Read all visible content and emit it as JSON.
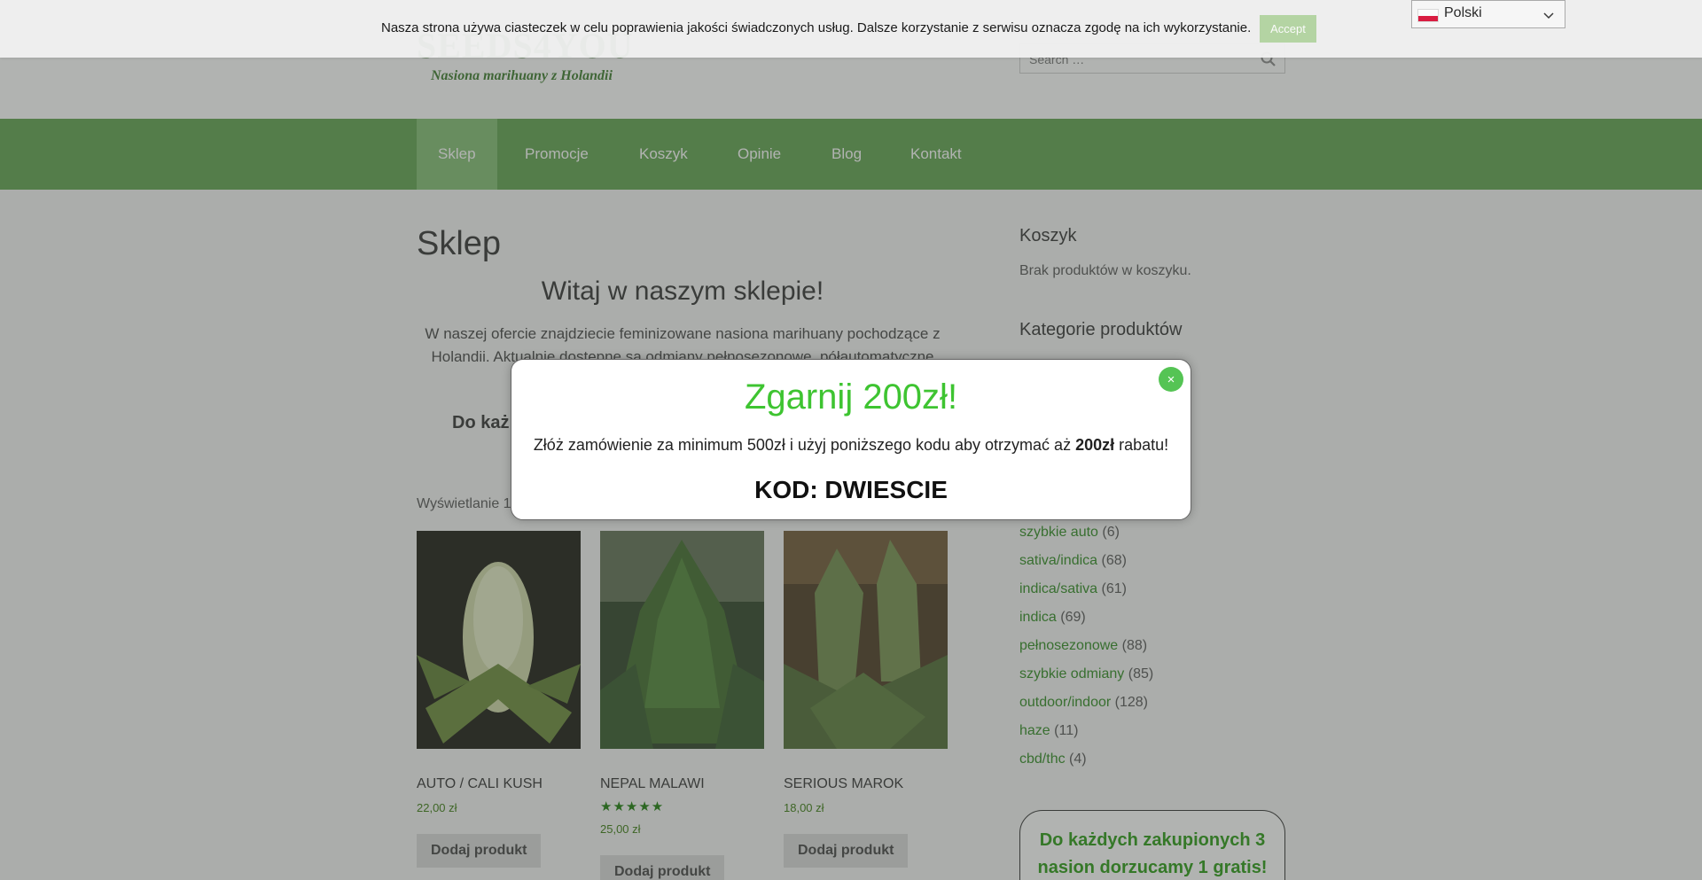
{
  "site": {
    "logo": "SEEDS4YOU",
    "tagline": "Nasiona marihuany z Holandii"
  },
  "search": {
    "placeholder": "Search …"
  },
  "nav": {
    "items": [
      {
        "label": "Sklep",
        "active": true
      },
      {
        "label": "Promocje"
      },
      {
        "label": "Koszyk"
      },
      {
        "label": "Opinie"
      },
      {
        "label": "Blog"
      },
      {
        "label": "Kontakt"
      }
    ]
  },
  "main": {
    "page_title": "Sklep",
    "welcome_title": "Witaj w naszym sklepie!",
    "welcome_text": "W naszej ofercie znajdziecie feminizowane nasiona marihuany pochodzące z Holandii. Aktualnie dostępne są odmiany pełnosezonowe, półautomatyczne jak i",
    "promo_line": "Do każ",
    "result_count": "Wyświetlanie 1",
    "products": [
      {
        "name": "AUTO / CALI KUSH",
        "price": "22,00 zł",
        "button": "Dodaj produkt",
        "rating": null
      },
      {
        "name": "NEPAL MALAWI",
        "price": "25,00 zł",
        "button": "Dodaj produkt",
        "rating": "★★★★★",
        "rating_value": 5
      },
      {
        "name": "SERIOUS MAROK",
        "price": "18,00 zł",
        "button": "Dodaj produkt",
        "rating": null
      }
    ]
  },
  "sidebar": {
    "cart_title": "Koszyk",
    "cart_empty": "Brak produktów w koszyku.",
    "categories_title": "Kategorie produktów",
    "categories": [
      {
        "name": "szybkie auto",
        "count": "(6)"
      },
      {
        "name": "sativa/indica",
        "count": "(68)"
      },
      {
        "name": "indica/sativa",
        "count": "(61)"
      },
      {
        "name": "indica",
        "count": "(69)"
      },
      {
        "name": "pełnosezonowe",
        "count": "(88)"
      },
      {
        "name": "szybkie odmiany",
        "count": "(85)"
      },
      {
        "name": "outdoor/indoor",
        "count": "(128)"
      },
      {
        "name": "haze",
        "count": "(11)"
      },
      {
        "name": "cbd/thc",
        "count": "(4)"
      }
    ],
    "gift_text": "Do każdych zakupionych 3 nasion dorzucamy 1 gratis!"
  },
  "cookie": {
    "text": "Nasza strona używa ciasteczek w celu poprawienia jakości świadczonych usług. Dalsze korzystanie z serwisu oznacza zgodę na ich wykorzystanie.",
    "accept_label": "Accept"
  },
  "language": {
    "selected": "Polski"
  },
  "popup": {
    "title": "Zgarnij 200zł!",
    "body_before": "Złóż zamówienie za minimum 500zł i użyj poniższego kodu aby otrzymać aż ",
    "body_bold": "200zł",
    "body_after": " rabatu!",
    "code": "KOD: DWIESCIE",
    "close_label": "×"
  },
  "colors": {
    "brand_green": "#60a34e",
    "popup_title_green": "#3ec431",
    "link_green": "#2f8a21"
  }
}
